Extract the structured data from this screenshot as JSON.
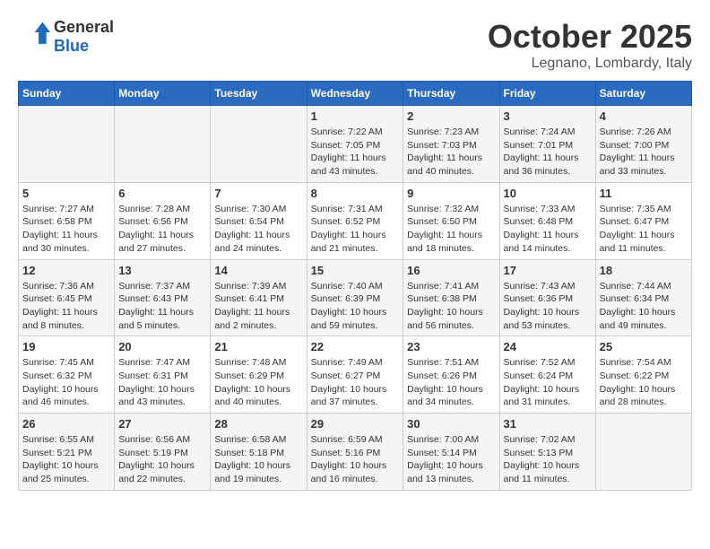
{
  "header": {
    "logo_general": "General",
    "logo_blue": "Blue",
    "month": "October 2025",
    "location": "Legnano, Lombardy, Italy"
  },
  "weekdays": [
    "Sunday",
    "Monday",
    "Tuesday",
    "Wednesday",
    "Thursday",
    "Friday",
    "Saturday"
  ],
  "weeks": [
    [
      {
        "day": "",
        "info": ""
      },
      {
        "day": "",
        "info": ""
      },
      {
        "day": "",
        "info": ""
      },
      {
        "day": "1",
        "info": "Sunrise: 7:22 AM\nSunset: 7:05 PM\nDaylight: 11 hours and 43 minutes."
      },
      {
        "day": "2",
        "info": "Sunrise: 7:23 AM\nSunset: 7:03 PM\nDaylight: 11 hours and 40 minutes."
      },
      {
        "day": "3",
        "info": "Sunrise: 7:24 AM\nSunset: 7:01 PM\nDaylight: 11 hours and 36 minutes."
      },
      {
        "day": "4",
        "info": "Sunrise: 7:26 AM\nSunset: 7:00 PM\nDaylight: 11 hours and 33 minutes."
      }
    ],
    [
      {
        "day": "5",
        "info": "Sunrise: 7:27 AM\nSunset: 6:58 PM\nDaylight: 11 hours and 30 minutes."
      },
      {
        "day": "6",
        "info": "Sunrise: 7:28 AM\nSunset: 6:56 PM\nDaylight: 11 hours and 27 minutes."
      },
      {
        "day": "7",
        "info": "Sunrise: 7:30 AM\nSunset: 6:54 PM\nDaylight: 11 hours and 24 minutes."
      },
      {
        "day": "8",
        "info": "Sunrise: 7:31 AM\nSunset: 6:52 PM\nDaylight: 11 hours and 21 minutes."
      },
      {
        "day": "9",
        "info": "Sunrise: 7:32 AM\nSunset: 6:50 PM\nDaylight: 11 hours and 18 minutes."
      },
      {
        "day": "10",
        "info": "Sunrise: 7:33 AM\nSunset: 6:48 PM\nDaylight: 11 hours and 14 minutes."
      },
      {
        "day": "11",
        "info": "Sunrise: 7:35 AM\nSunset: 6:47 PM\nDaylight: 11 hours and 11 minutes."
      }
    ],
    [
      {
        "day": "12",
        "info": "Sunrise: 7:36 AM\nSunset: 6:45 PM\nDaylight: 11 hours and 8 minutes."
      },
      {
        "day": "13",
        "info": "Sunrise: 7:37 AM\nSunset: 6:43 PM\nDaylight: 11 hours and 5 minutes."
      },
      {
        "day": "14",
        "info": "Sunrise: 7:39 AM\nSunset: 6:41 PM\nDaylight: 11 hours and 2 minutes."
      },
      {
        "day": "15",
        "info": "Sunrise: 7:40 AM\nSunset: 6:39 PM\nDaylight: 10 hours and 59 minutes."
      },
      {
        "day": "16",
        "info": "Sunrise: 7:41 AM\nSunset: 6:38 PM\nDaylight: 10 hours and 56 minutes."
      },
      {
        "day": "17",
        "info": "Sunrise: 7:43 AM\nSunset: 6:36 PM\nDaylight: 10 hours and 53 minutes."
      },
      {
        "day": "18",
        "info": "Sunrise: 7:44 AM\nSunset: 6:34 PM\nDaylight: 10 hours and 49 minutes."
      }
    ],
    [
      {
        "day": "19",
        "info": "Sunrise: 7:45 AM\nSunset: 6:32 PM\nDaylight: 10 hours and 46 minutes."
      },
      {
        "day": "20",
        "info": "Sunrise: 7:47 AM\nSunset: 6:31 PM\nDaylight: 10 hours and 43 minutes."
      },
      {
        "day": "21",
        "info": "Sunrise: 7:48 AM\nSunset: 6:29 PM\nDaylight: 10 hours and 40 minutes."
      },
      {
        "day": "22",
        "info": "Sunrise: 7:49 AM\nSunset: 6:27 PM\nDaylight: 10 hours and 37 minutes."
      },
      {
        "day": "23",
        "info": "Sunrise: 7:51 AM\nSunset: 6:26 PM\nDaylight: 10 hours and 34 minutes."
      },
      {
        "day": "24",
        "info": "Sunrise: 7:52 AM\nSunset: 6:24 PM\nDaylight: 10 hours and 31 minutes."
      },
      {
        "day": "25",
        "info": "Sunrise: 7:54 AM\nSunset: 6:22 PM\nDaylight: 10 hours and 28 minutes."
      }
    ],
    [
      {
        "day": "26",
        "info": "Sunrise: 6:55 AM\nSunset: 5:21 PM\nDaylight: 10 hours and 25 minutes."
      },
      {
        "day": "27",
        "info": "Sunrise: 6:56 AM\nSunset: 5:19 PM\nDaylight: 10 hours and 22 minutes."
      },
      {
        "day": "28",
        "info": "Sunrise: 6:58 AM\nSunset: 5:18 PM\nDaylight: 10 hours and 19 minutes."
      },
      {
        "day": "29",
        "info": "Sunrise: 6:59 AM\nSunset: 5:16 PM\nDaylight: 10 hours and 16 minutes."
      },
      {
        "day": "30",
        "info": "Sunrise: 7:00 AM\nSunset: 5:14 PM\nDaylight: 10 hours and 13 minutes."
      },
      {
        "day": "31",
        "info": "Sunrise: 7:02 AM\nSunset: 5:13 PM\nDaylight: 10 hours and 11 minutes."
      },
      {
        "day": "",
        "info": ""
      }
    ]
  ]
}
